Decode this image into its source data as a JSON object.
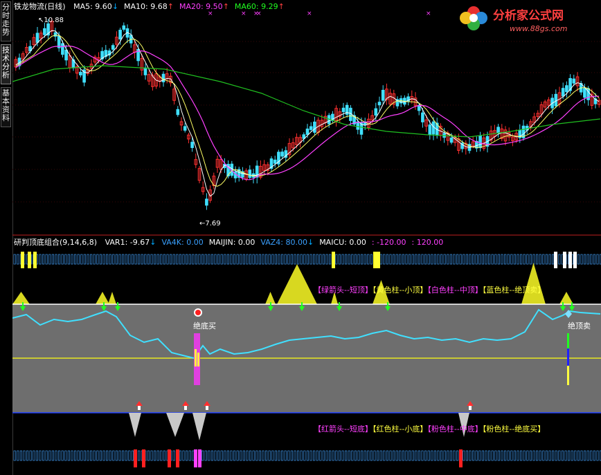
{
  "sidebar": {
    "tabs": [
      {
        "label": "分时走势",
        "active": false
      },
      {
        "label": "技术分析",
        "active": true
      },
      {
        "label": "基本资料",
        "active": false
      }
    ]
  },
  "top_panel": {
    "stock_title": "铁龙物流(日线)",
    "indicators": [
      {
        "label": "MA5: 9.60",
        "color": "#ffffff",
        "arrow": "↓",
        "arrow_color": "#00aaff"
      },
      {
        "label": "MA10: 9.68",
        "color": "#ffffff",
        "arrow": "↑",
        "arrow_color": "#ff4040"
      },
      {
        "label": "MA20: 9.50",
        "color": "#ff40ff",
        "arrow": "↑",
        "arrow_color": "#ff4040"
      },
      {
        "label": "MA60: 9.29",
        "color": "#20ff20",
        "arrow": "↑",
        "arrow_color": "#ff4040"
      }
    ],
    "high_label": "10.88",
    "low_label": "7.69"
  },
  "logo": {
    "name": "分析家公式网",
    "url": "www.88gs.com"
  },
  "bottom_panel": {
    "indicator_title": "研判顶底组合(9,14,6,8)",
    "stats": [
      {
        "label": "VAR1: -9.67",
        "color": "#ffffff",
        "arrow": "↓",
        "arrow_color": "#00aaff"
      },
      {
        "label": "VA4K: 0.00",
        "color": "#3aa0ff"
      },
      {
        "label": "MAIJIN: 0.00",
        "color": "#ffffff"
      },
      {
        "label": "VAZ4: 80.00",
        "color": "#3aa0ff",
        "arrow": "↓",
        "arrow_color": "#00aaff"
      },
      {
        "label": "MAICU: 0.00",
        "color": "#ffffff"
      },
      {
        "label": ": -120.00",
        "color": "#ff40ff"
      },
      {
        "label": ": 120.00",
        "color": "#ff40ff"
      }
    ],
    "top_legend": [
      "【绿箭头--短顶】",
      "【黄色柱--小顶】",
      "【白色柱--中顶】",
      "【蓝色柱--绝顶卖】"
    ],
    "bottom_legend": [
      "【红箭头--短底】",
      "【红色柱--小底】",
      "【粉色柱--中底】",
      "【粉色柱--绝底买】"
    ],
    "sell_label": "绝顶卖",
    "buy_label": "绝底买"
  },
  "colors": {
    "bg": "#000000",
    "up": "#ff3030",
    "down": "#40e0ff",
    "ma5": "#ffffff",
    "ma10": "#ffff66",
    "ma20": "#ff40ff",
    "ma60": "#20c020",
    "gray_panel": "#6e6e6e",
    "cyan_line": "#40e0ff",
    "yellow": "#d8d820"
  }
}
